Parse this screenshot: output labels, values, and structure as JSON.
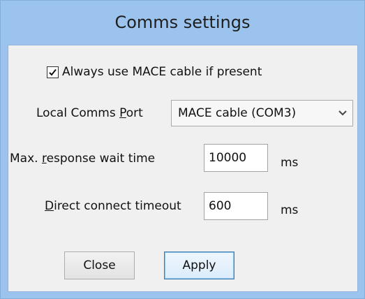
{
  "window": {
    "title": "Comms settings"
  },
  "always_use_mace": {
    "label": "Always use MACE cable if present",
    "checked": true
  },
  "local_comms_port": {
    "label": "Local Comms Port",
    "value": "MACE cable (COM3)"
  },
  "max_response_wait": {
    "label": "Max. response wait time",
    "value": "10000",
    "unit": "ms"
  },
  "direct_connect_timeout": {
    "label": "Direct connect timeout",
    "value": "600",
    "unit": "ms"
  },
  "buttons": {
    "close": "Close",
    "apply": "Apply"
  },
  "colors": {
    "frame": "#9cc3ee",
    "client": "#f0f0f0",
    "default_button_border": "#3c7fb1"
  },
  "icons": {
    "checkbox": "check-mark-icon",
    "combo": "chevron-down-icon"
  }
}
